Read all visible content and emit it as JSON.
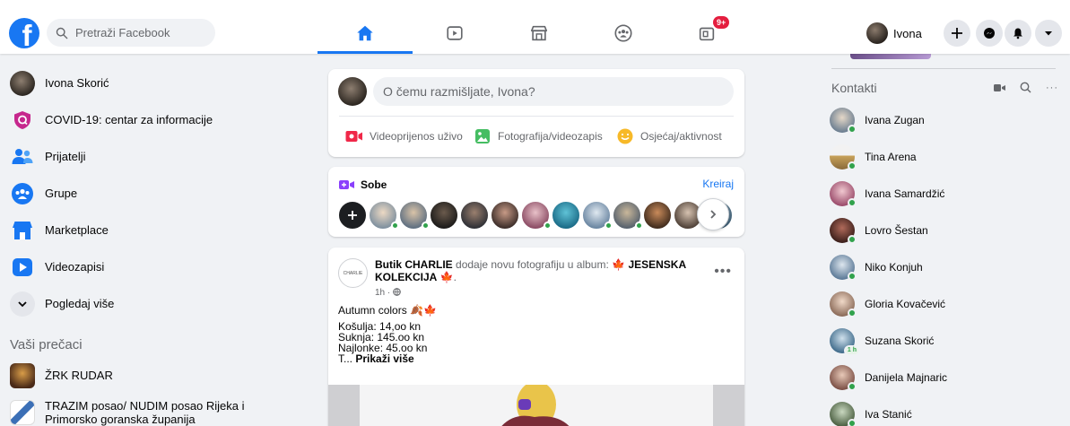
{
  "search": {
    "placeholder": "Pretraži Facebook"
  },
  "nav": {
    "tabs": [
      "home",
      "watch",
      "marketplace",
      "groups",
      "gaming"
    ],
    "notif_badge": "9+"
  },
  "profile": {
    "name": "Ivona"
  },
  "left": {
    "items": [
      {
        "label": "Ivona Skorić",
        "icon": "profile-avatar"
      },
      {
        "label": "COVID-19: centar za informacije",
        "icon": "covid-shield-icon"
      },
      {
        "label": "Prijatelji",
        "icon": "friends-icon"
      },
      {
        "label": "Grupe",
        "icon": "groups-icon"
      },
      {
        "label": "Marketplace",
        "icon": "marketplace-icon"
      },
      {
        "label": "Videozapisi",
        "icon": "video-icon"
      },
      {
        "label": "Pogledaj više",
        "icon": "chevron-down-icon"
      }
    ],
    "shortcuts_title": "Vaši prečaci",
    "shortcuts": [
      {
        "label": "ŽRK RUDAR"
      },
      {
        "label_line1": "TRAZIM posao/ NUDIM posao Rijeka i",
        "label_line2": "Primorsko goranska županija"
      }
    ]
  },
  "composer": {
    "placeholder": "O čemu razmišljate, Ivona?",
    "actions": [
      "Videoprijenos uživo",
      "Fotografija/videozapis",
      "Osjećaj/aktivnost"
    ]
  },
  "rooms": {
    "title": "Sobe",
    "create": "Kreiraj"
  },
  "post": {
    "page": "Butik CHARLIE",
    "action_text": "dodaje novu fotografiju u album:",
    "album": "JESENSKA KOLEKCIJA",
    "time": "1h ·",
    "logo_text": "CHARLIE",
    "lines": [
      "Autumn colors",
      "Košulja: 14,oo kn",
      "Suknja: 145.oo kn",
      "Najlonke: 45.oo kn"
    ],
    "truncated_prefix": "T... ",
    "see_more": "Prikaži više",
    "more_icon": "•••"
  },
  "contacts": {
    "title": "Kontakti",
    "list": [
      {
        "name": "Ivana Zugan",
        "status": "online"
      },
      {
        "name": "Tina Arena",
        "status": "online"
      },
      {
        "name": "Ivana Samardžić",
        "status": "online"
      },
      {
        "name": "Lovro Šestan",
        "status": "online"
      },
      {
        "name": "Niko Konjuh",
        "status": "online"
      },
      {
        "name": "Gloria Kovačević",
        "status": "online"
      },
      {
        "name": "Suzana Skorić",
        "status": "1 h"
      },
      {
        "name": "Danijela Majnaric",
        "status": "online"
      },
      {
        "name": "Iva Stanić",
        "status": "online"
      }
    ]
  },
  "colors": {
    "brand": "#1877f2",
    "online": "#31a24c",
    "badge": "#e41e3f",
    "background": "#f0f2f5"
  }
}
